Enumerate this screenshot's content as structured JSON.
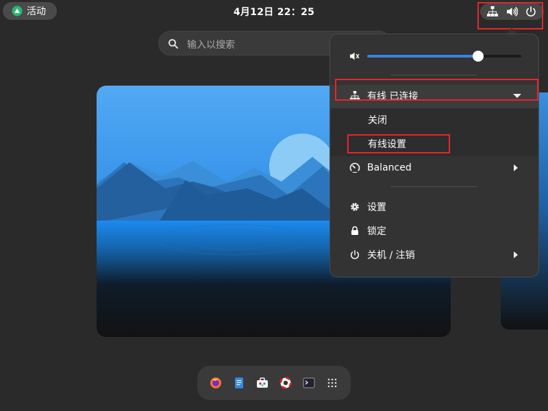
{
  "topbar": {
    "activities_label": "活动",
    "clock": "4月12日  22：25",
    "status_icons": [
      "network-wired-icon",
      "volume-icon",
      "power-icon"
    ]
  },
  "search": {
    "placeholder": "输入以搜索"
  },
  "quick_settings": {
    "volume": {
      "level": 0.72,
      "icon": "volume-muted-icon"
    },
    "network": {
      "label": "有线 已连接",
      "icon": "network-wired-icon"
    },
    "network_submenu": [
      {
        "label": "关闭"
      },
      {
        "label": "有线设置"
      }
    ],
    "power_mode": {
      "label": "Balanced",
      "icon": "power-profile-icon"
    },
    "items": [
      {
        "label": "设置",
        "icon": "gear-icon"
      },
      {
        "label": "锁定",
        "icon": "lock-icon"
      },
      {
        "label": "关机 / 注销",
        "icon": "power-icon"
      }
    ]
  },
  "dash": {
    "apps": [
      "firefox-icon",
      "text-editor-icon",
      "software-icon",
      "help-icon",
      "terminal-icon",
      "app-grid-icon"
    ]
  },
  "colors": {
    "accent": "#3584e4",
    "highlight": "#e8252c",
    "background": "#2a2a2a"
  }
}
